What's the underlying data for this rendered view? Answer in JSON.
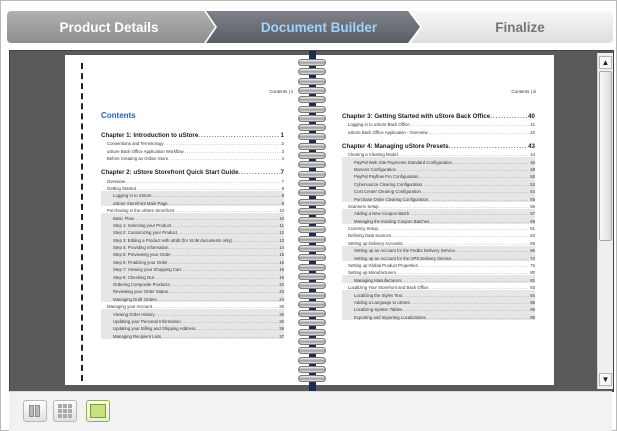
{
  "wizard": {
    "steps": [
      {
        "label": "Product Details",
        "state": "completed"
      },
      {
        "label": "Document Builder",
        "state": "active"
      },
      {
        "label": "Finalize",
        "state": "upcoming"
      }
    ]
  },
  "document": {
    "left_page": {
      "header": "Contents | ii",
      "title": "Contents",
      "entries": [
        {
          "level": 1,
          "text": "Chapter 1: Introduction to uStore",
          "page": "1"
        },
        {
          "level": 2,
          "text": "Conventions and Terminology",
          "page": "2"
        },
        {
          "level": 2,
          "text": "uStore Back Office Application Workflow",
          "page": "3"
        },
        {
          "level": 2,
          "text": "Before Creating an Online Store",
          "page": "4"
        },
        {
          "level": 1,
          "text": "Chapter 2: uStore Storefront Quick Start Guide",
          "page": "7"
        },
        {
          "level": 2,
          "text": "Overview",
          "page": "7"
        },
        {
          "level": 2,
          "text": "Getting Started",
          "page": "8"
        },
        {
          "level": 3,
          "text": "Logging in to uStore",
          "page": "8"
        },
        {
          "level": 3,
          "text": "uStore Storefront Main Page",
          "page": "9"
        },
        {
          "level": 2,
          "text": "Purchasing in the uStore Storefront",
          "page": "10"
        },
        {
          "level": 3,
          "text": "Basic Flow",
          "page": "10"
        },
        {
          "level": 3,
          "text": "Step 1: Selecting your Product",
          "page": "11"
        },
        {
          "level": 3,
          "text": "Step 2: Customizing your Product",
          "page": "12"
        },
        {
          "level": 3,
          "text": "Step 3: Editing a Product with uEdit (for XLIM documents only)",
          "page": "13"
        },
        {
          "level": 3,
          "text": "Step 4: Providing Information",
          "page": "14"
        },
        {
          "level": 3,
          "text": "Step 5: Previewing your Order",
          "page": "15"
        },
        {
          "level": 3,
          "text": "Step 6: Finalizing your Order",
          "page": "16"
        },
        {
          "level": 3,
          "text": "Step 7: Viewing your Shopping Cart",
          "page": "18"
        },
        {
          "level": 3,
          "text": "Step 8: Checking Out",
          "page": "19"
        },
        {
          "level": 3,
          "text": "Ordering Composite Products",
          "page": "22"
        },
        {
          "level": 3,
          "text": "Reviewing your Order Status",
          "page": "23"
        },
        {
          "level": 3,
          "text": "Managing Draft Orders",
          "page": "24"
        },
        {
          "level": 2,
          "text": "Managing your Account",
          "page": "25"
        },
        {
          "level": 3,
          "text": "Viewing Order History",
          "page": "25"
        },
        {
          "level": 3,
          "text": "Updating your Personal Information",
          "page": "26"
        },
        {
          "level": 3,
          "text": "Updating your Billing and Shipping Address",
          "page": "26"
        },
        {
          "level": 3,
          "text": "Managing Recipient Lists",
          "page": "27"
        }
      ]
    },
    "right_page": {
      "header": "Contents | iii",
      "entries": [
        {
          "level": 1,
          "text": "Chapter 3: Getting Started with uStore Back Office",
          "page": "40"
        },
        {
          "level": 2,
          "text": "Logging in to uStore Back Office",
          "page": "41"
        },
        {
          "level": 2,
          "text": "uStore Back Office Application - Overview",
          "page": "42"
        },
        {
          "level": 1,
          "text": "Chapter 4: Managing uStore Presets",
          "page": "43"
        },
        {
          "level": 2,
          "text": "Clearing a Clearing Model",
          "page": "44"
        },
        {
          "level": 3,
          "text": "PayPal Web Site Payments Standard Configuration",
          "page": "46"
        },
        {
          "level": 3,
          "text": "Moneris Configuration",
          "page": "48"
        },
        {
          "level": 3,
          "text": "PayPal Payflow Pro Configuration",
          "page": "50"
        },
        {
          "level": 3,
          "text": "Cybersource Clearing Configuration",
          "page": "52"
        },
        {
          "level": 3,
          "text": "Cost Center Clearing Configuration",
          "page": "54"
        },
        {
          "level": 3,
          "text": "Purchase Order Clearing Configuration",
          "page": "55"
        },
        {
          "level": 2,
          "text": "Scanners Setup",
          "page": "56"
        },
        {
          "level": 3,
          "text": "Adding a New Coupon Batch",
          "page": "57"
        },
        {
          "level": 3,
          "text": "Managing the Existing Coupon Batches",
          "page": "59"
        },
        {
          "level": 2,
          "text": "Currency Setup",
          "page": "61"
        },
        {
          "level": 2,
          "text": "Defining Data Sources",
          "page": "63"
        },
        {
          "level": 2,
          "text": "Setting up Delivery Accounts",
          "page": "65"
        },
        {
          "level": 3,
          "text": "Setting up an Account for the FedEx Delivery Service",
          "page": "66"
        },
        {
          "level": 3,
          "text": "Setting up an Account for the UPS Delivery Service",
          "page": "72"
        },
        {
          "level": 2,
          "text": "Setting up Global Product Properties",
          "page": "76"
        },
        {
          "level": 2,
          "text": "Setting up Manufacturers",
          "page": "80"
        },
        {
          "level": 3,
          "text": "Managing Manufacturers",
          "page": "81"
        },
        {
          "level": 2,
          "text": "Localizing Your Storefront and Back Office",
          "page": "83"
        },
        {
          "level": 3,
          "text": "Localizing the Styles Text",
          "page": "84"
        },
        {
          "level": 3,
          "text": "Adding a Language to uStore",
          "page": "85"
        },
        {
          "level": 3,
          "text": "Localizing System Tables",
          "page": "86"
        },
        {
          "level": 3,
          "text": "Exporting and Importing Localizations",
          "page": "88"
        }
      ]
    }
  },
  "scrollbar": {
    "up_arrow": "▲",
    "down_arrow": "▼"
  },
  "toolbar": {
    "buttons": [
      {
        "name": "single-page-view",
        "active": false
      },
      {
        "name": "thumbnail-grid-view",
        "active": false
      },
      {
        "name": "spread-view",
        "active": true
      }
    ]
  },
  "colors": {
    "active_step_text": "#9fd3ff",
    "toc_title": "#2b64b4",
    "binding": "#1d2b55"
  }
}
